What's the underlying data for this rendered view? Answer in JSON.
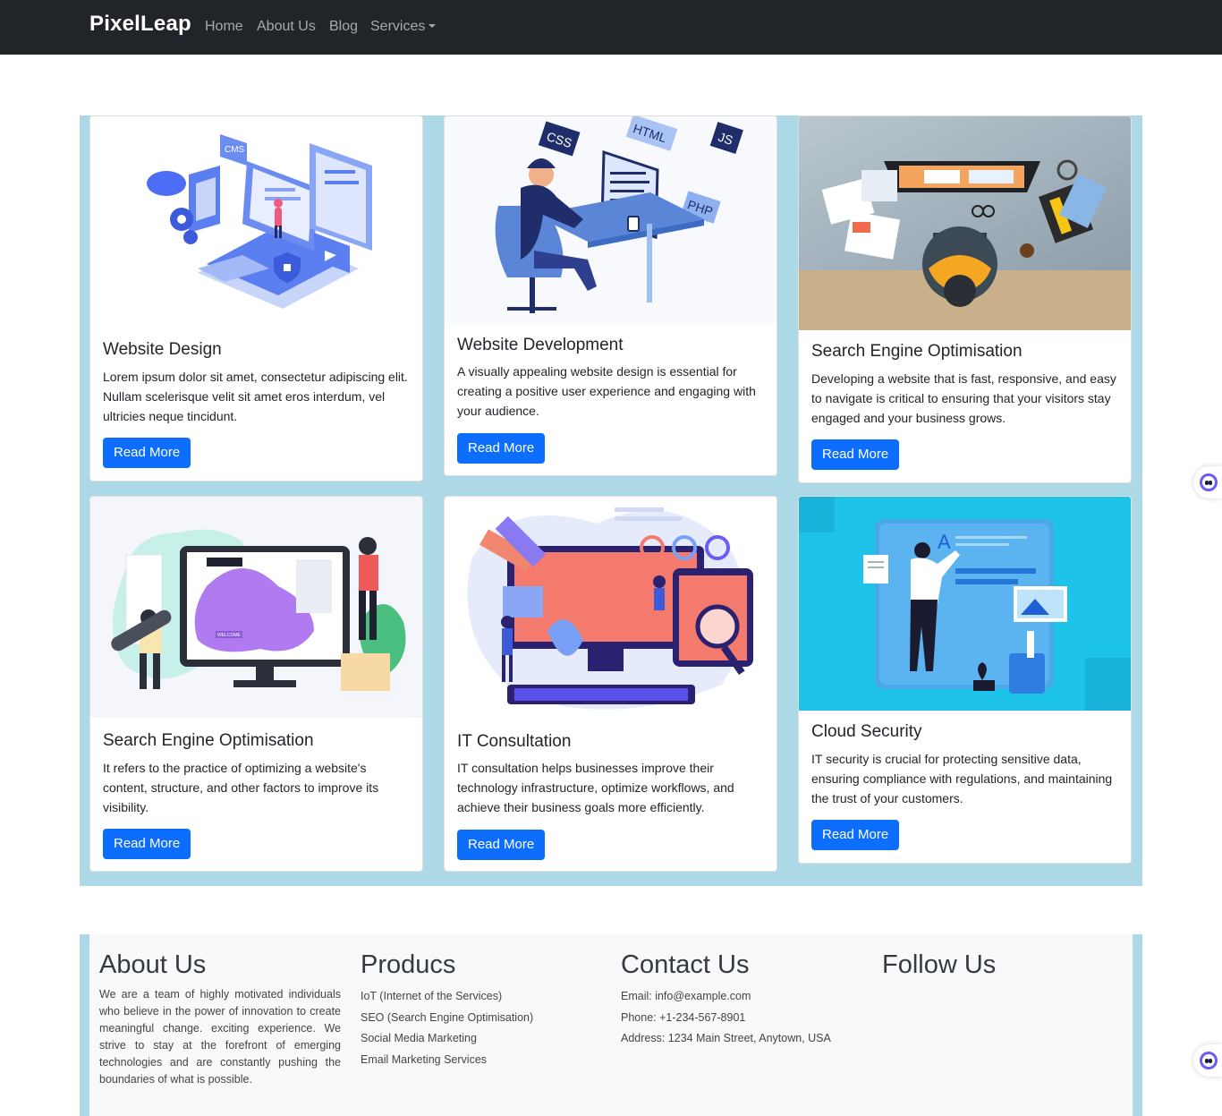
{
  "navbar": {
    "brand": "PixelLeap",
    "links": {
      "home": "Home",
      "about": "About Us",
      "blog": "Blog",
      "services": "Services"
    }
  },
  "cards": [
    {
      "title": "Website Design",
      "text": "Lorem ipsum dolor sit amet, consectetur adipiscing elit. Nullam scelerisque velit sit amet eros interdum, vel ultricies neque tincidunt.",
      "button": "Read More",
      "image_labels": {
        "cms": "CMS"
      }
    },
    {
      "title": "Website Development",
      "text": "A visually appealing website design is essential for creating a positive user experience and engaging with your audience.",
      "button": "Read More",
      "image_labels": {
        "css": "CSS",
        "html": "HTML",
        "js": "JS",
        "php": "PHP"
      }
    },
    {
      "title": "Search Engine Optimisation",
      "text": "Developing a website that is fast, responsive, and easy to navigate is critical to ensuring that your visitors stay engaged and your business grows.",
      "button": "Read More"
    },
    {
      "title": "Search Engine Optimisation",
      "text": "It refers to the practice of optimizing a website's content, structure, and other factors to improve its visibility.",
      "button": "Read More",
      "image_labels": {
        "welcome": "WELCOME"
      }
    },
    {
      "title": "IT Consultation",
      "text": "IT consultation helps businesses improve their technology infrastructure, optimize workflows, and achieve their business goals more efficiently.",
      "button": "Read More"
    },
    {
      "title": "Cloud Security",
      "text": "IT security is crucial for protecting sensitive data, ensuring compliance with regulations, and maintaining the trust of your customers.",
      "button": "Read More",
      "image_labels": {
        "letter": "A"
      }
    }
  ],
  "footer": {
    "about": {
      "heading": "About Us",
      "text": "We are a team of highly motivated individuals who believe in the power of innovation to create meaningful change. exciting experience. We strive to stay at the forefront of emerging technologies and are constantly pushing the boundaries of what is possible."
    },
    "products": {
      "heading": "Producs",
      "items": [
        "IoT (Internet of the Services)",
        "SEO (Search Engine Optimisation)",
        "Social Media Marketing",
        "Email Marketing Services"
      ]
    },
    "contact": {
      "heading": "Contact Us",
      "email": "Email: info@example.com",
      "phone": "Phone: +1-234-567-8901",
      "address": "Address: 1234 Main Street, Anytown, USA"
    },
    "follow": {
      "heading": "Follow Us"
    }
  },
  "colors": {
    "navbar": "#212529",
    "section_bg": "#add8e6",
    "button": "#0d6efd",
    "footer_bg": "#f8f9fa"
  },
  "icons": [
    "assistant-bot-icon"
  ]
}
